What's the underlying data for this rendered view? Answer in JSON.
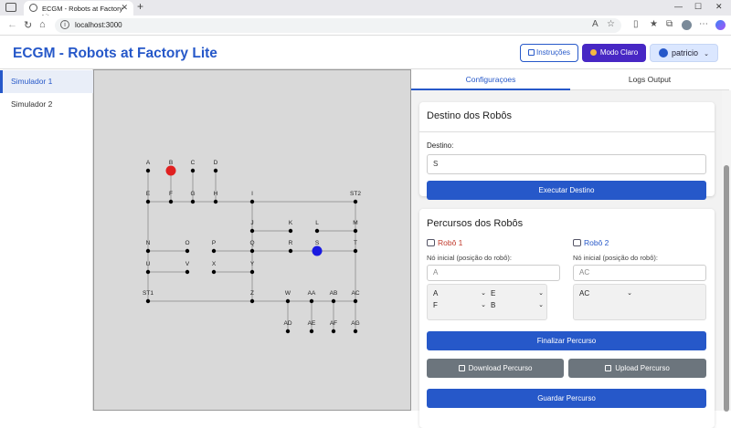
{
  "browser": {
    "tab_title": "ECGM - Robots at Factory Lite",
    "url": "localhost:3000"
  },
  "header": {
    "title": "ECGM - Robots at Factory Lite",
    "instrucoes": "Instruções",
    "modo": "Modo Claro",
    "user": "patricio"
  },
  "sidebar": {
    "items": [
      {
        "label": "Simulador 1"
      },
      {
        "label": "Simulador 2"
      }
    ]
  },
  "graph": {
    "nodes": [
      {
        "id": "A"
      },
      {
        "id": "B"
      },
      {
        "id": "C"
      },
      {
        "id": "D"
      },
      {
        "id": "E"
      },
      {
        "id": "F"
      },
      {
        "id": "G"
      },
      {
        "id": "H"
      },
      {
        "id": "I"
      },
      {
        "id": "ST2"
      },
      {
        "id": "J"
      },
      {
        "id": "K"
      },
      {
        "id": "L"
      },
      {
        "id": "M"
      },
      {
        "id": "N"
      },
      {
        "id": "O"
      },
      {
        "id": "P"
      },
      {
        "id": "Q"
      },
      {
        "id": "R"
      },
      {
        "id": "S"
      },
      {
        "id": "T"
      },
      {
        "id": "U"
      },
      {
        "id": "V"
      },
      {
        "id": "X"
      },
      {
        "id": "Y"
      },
      {
        "id": "ST1"
      },
      {
        "id": "Z"
      },
      {
        "id": "W"
      },
      {
        "id": "AA"
      },
      {
        "id": "AB"
      },
      {
        "id": "AC"
      },
      {
        "id": "AD"
      },
      {
        "id": "AE"
      },
      {
        "id": "AF"
      },
      {
        "id": "AG"
      }
    ],
    "robot1_color": "#e02020",
    "robot2_color": "#1a1ae0"
  },
  "right": {
    "tabs": [
      {
        "label": "Configuraçoes"
      },
      {
        "label": "Logs Output"
      }
    ],
    "destino": {
      "title": "Destino dos Robôs",
      "label": "Destino:",
      "value": "S",
      "button": "Executar Destino"
    },
    "percursos": {
      "title": "Percursos dos Robôs",
      "robo1": {
        "name": "Robô 1",
        "label": "Nó inicial (posição do robô):",
        "placeholder": "A",
        "selects": [
          "A",
          "E",
          "F",
          "B"
        ]
      },
      "robo2": {
        "name": "Robô 2",
        "label": "Nó inicial (posição do robô):",
        "placeholder": "AC",
        "selects": [
          "AC"
        ]
      },
      "finalizar": "Finalizar Percurso",
      "download": "Download Percurso",
      "upload": "Upload Percurso",
      "guardar": "Guardar Percurso"
    }
  },
  "colors": {
    "accent": "#2658c9",
    "modo_bg": "#4727c4",
    "robot1_label": "#c0392b",
    "robot2_label": "#2658c9"
  }
}
